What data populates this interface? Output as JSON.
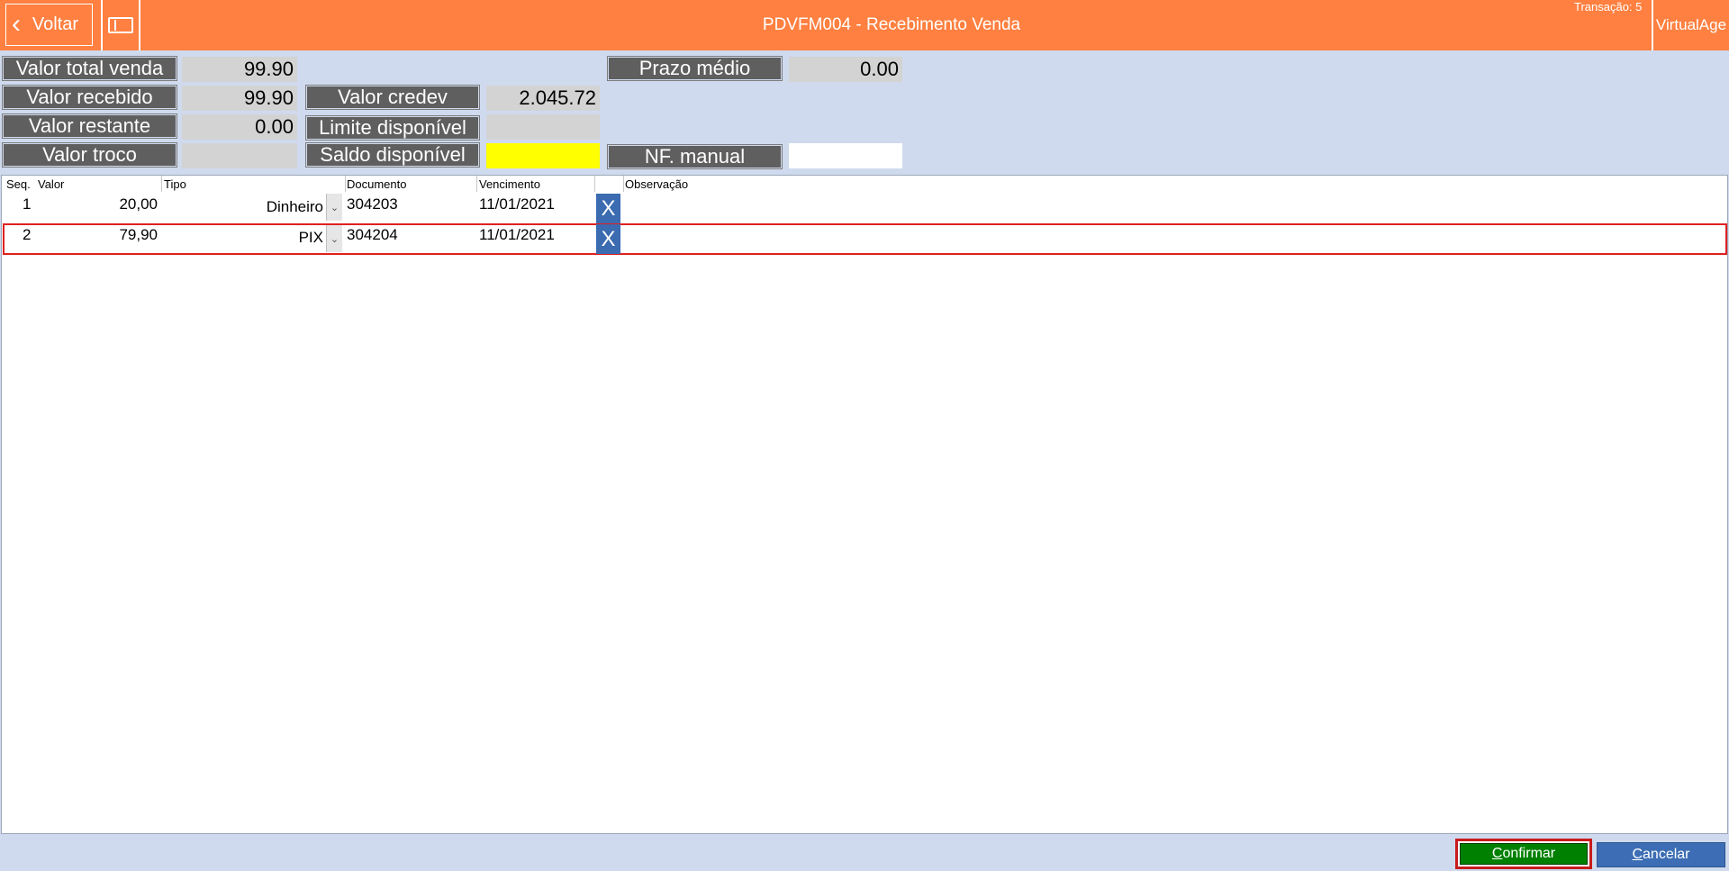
{
  "header": {
    "back_label": "Voltar",
    "back_chevron": "‹",
    "title": "PDVFM004 - Recebimento Venda",
    "transacao": "Transação: 5",
    "app_name": "VirtualAge",
    "bar_color": "#ff8040"
  },
  "summary": {
    "valor_total_venda": {
      "label": "Valor total venda",
      "value": "99.90"
    },
    "valor_recebido": {
      "label": "Valor recebido",
      "value": "99.90"
    },
    "valor_restante": {
      "label": "Valor restante",
      "value": "0.00"
    },
    "valor_troco": {
      "label": "Valor troco",
      "value": ""
    },
    "valor_credev": {
      "label": "Valor credev",
      "value": "2.045.72"
    },
    "limite_disponivel": {
      "label": "Limite disponível",
      "value": ""
    },
    "saldo_disponivel": {
      "label": "Saldo disponível",
      "value": ""
    },
    "prazo_medio": {
      "label": "Prazo médio",
      "value": "0.00"
    },
    "nf_manual": {
      "label": "NF. manual",
      "value": ""
    }
  },
  "grid": {
    "columns": {
      "seq": "Seq.",
      "valor": "Valor",
      "tipo": "Tipo",
      "documento": "Documento",
      "vencimento": "Vencimento",
      "observacao": "Observação"
    },
    "rows": [
      {
        "seq": "1",
        "valor": "20,00",
        "tipo": "Dinheiro",
        "documento": "304203",
        "vencimento": "11/01/2021",
        "observacao": "",
        "delete_icon": "X"
      },
      {
        "seq": "2",
        "valor": "79,90",
        "tipo": "PIX",
        "documento": "304204",
        "vencimento": "11/01/2021",
        "observacao": "",
        "delete_icon": "X",
        "selected": true
      }
    ],
    "combo_arrow": "⌄"
  },
  "footer": {
    "confirm_label": "Confirmar",
    "cancel_label": "Cancelar",
    "confirm_color": "#008000",
    "cancel_color": "#3d6eb5"
  }
}
